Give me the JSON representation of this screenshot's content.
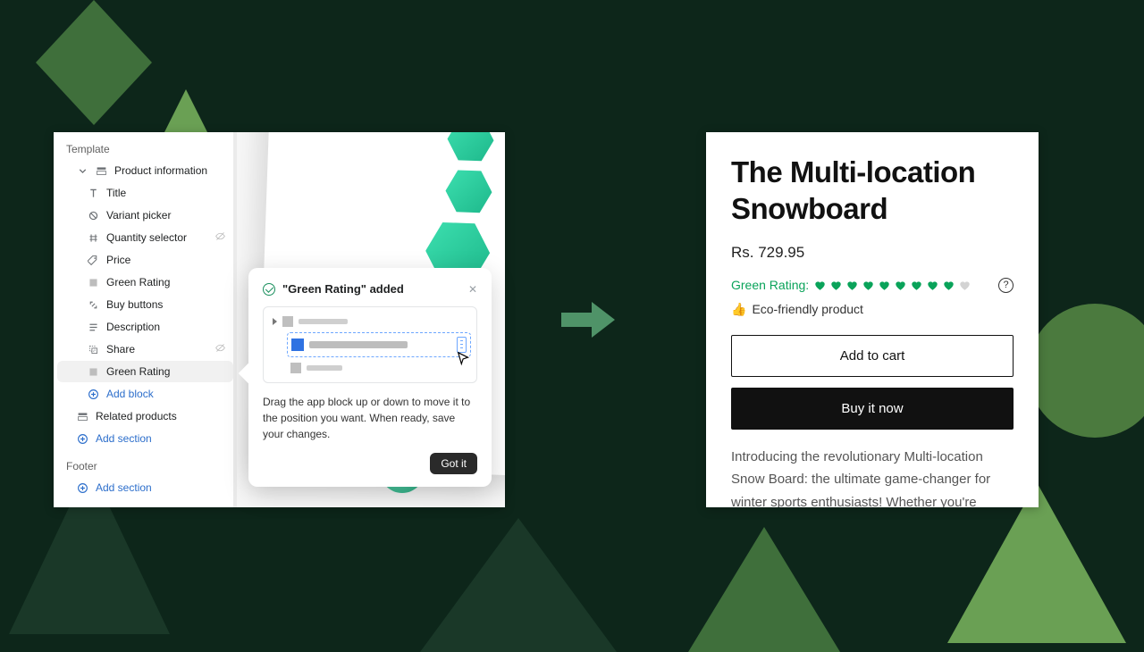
{
  "sidebar": {
    "template_label": "Template",
    "product_info_label": "Product information",
    "items": [
      {
        "label": "Title"
      },
      {
        "label": "Variant picker"
      },
      {
        "label": "Quantity selector"
      },
      {
        "label": "Price"
      },
      {
        "label": "Green Rating"
      },
      {
        "label": "Buy buttons"
      },
      {
        "label": "Description"
      },
      {
        "label": "Share"
      },
      {
        "label": "Green Rating"
      }
    ],
    "add_block_label": "Add block",
    "related_label": "Related products",
    "add_section_label": "Add section",
    "footer_label": "Footer"
  },
  "tip": {
    "title": "\"Green Rating\" added",
    "body": "Drag the app block up or down to move it to the position you want. When ready, save your changes.",
    "button": "Got it"
  },
  "product": {
    "title": "The Multi-location Snowboard",
    "price": "Rs. 729.95",
    "rating_label": "Green Rating:",
    "rating_filled": 9,
    "rating_total": 10,
    "eco_label": "Eco-friendly product",
    "add_to_cart": "Add to cart",
    "buy_now": "Buy it now",
    "description": "Introducing the revolutionary Multi-location Snow Board: the ultimate game-changer for winter sports enthusiasts! Whether you're"
  }
}
